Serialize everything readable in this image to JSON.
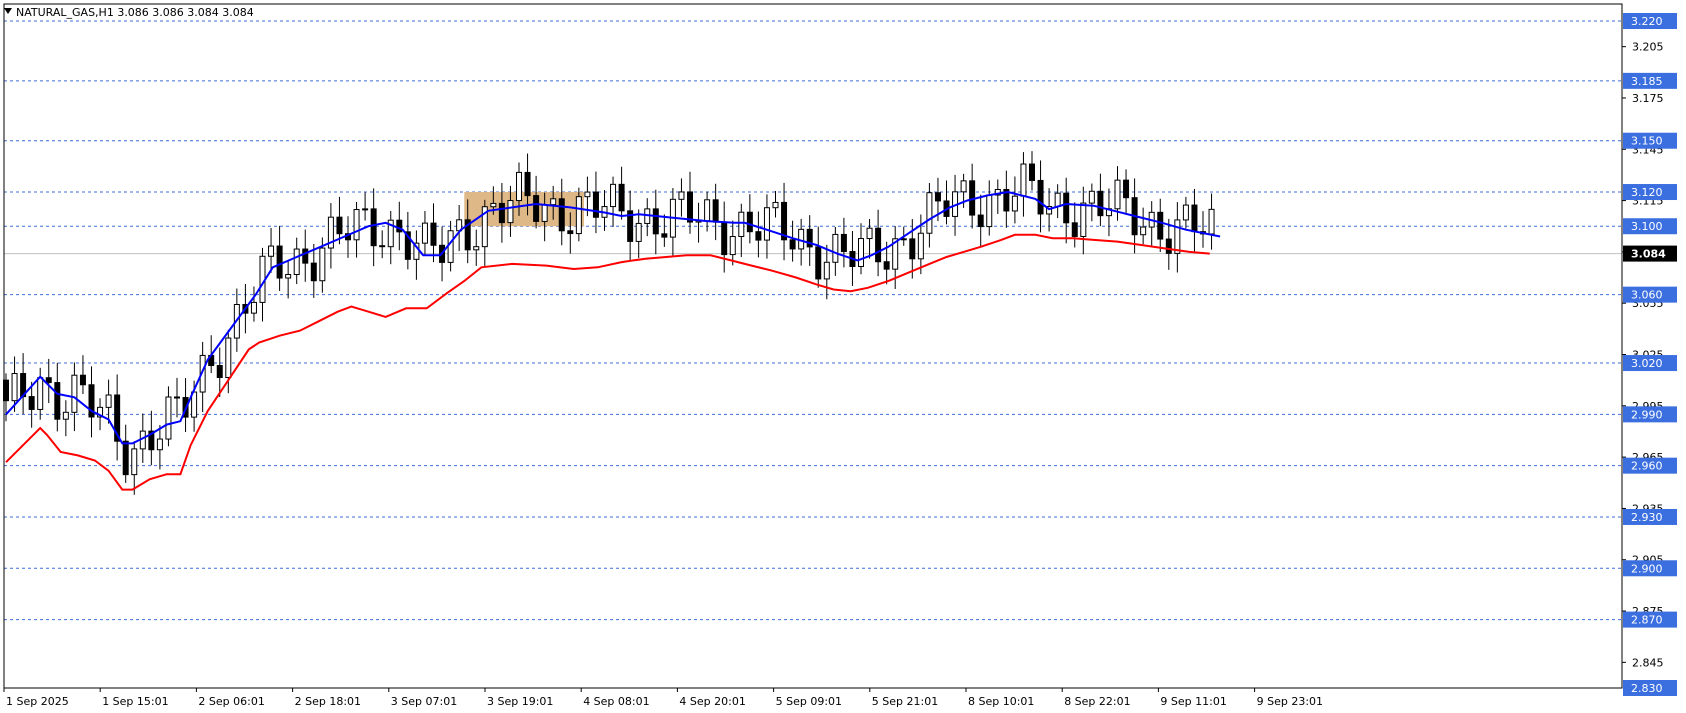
{
  "chart_data": {
    "type": "candlestick",
    "title": "NATURAL_GAS,H1  3.086 3.086 3.084 3.084",
    "symbol": "NATURAL_GAS,H1",
    "ohlc_header": "3.086 3.086 3.084 3.084",
    "current_price": 3.084,
    "ylim": [
      2.83,
      3.22
    ],
    "price_tick_labels": [
      "3.205",
      "3.175",
      "3.145",
      "3.115",
      "3.085",
      "3.055",
      "3.025",
      "2.995",
      "2.965",
      "2.935",
      "2.905",
      "2.875",
      "2.845"
    ],
    "horizontal_levels": [
      3.22,
      3.185,
      3.15,
      3.12,
      3.1,
      3.06,
      3.02,
      2.99,
      2.96,
      2.93,
      2.9,
      2.87,
      2.83
    ],
    "horizontal_level_labels": [
      "3.220",
      "3.185",
      "3.150",
      "3.120",
      "3.100",
      "3.060",
      "3.020",
      "2.990",
      "2.960",
      "2.930",
      "2.900",
      "2.870",
      "2.830"
    ],
    "time_labels": [
      "1 Sep 2025",
      "1 Sep 15:01",
      "2 Sep 06:01",
      "2 Sep 18:01",
      "3 Sep 07:01",
      "3 Sep 19:01",
      "4 Sep 08:01",
      "4 Sep 20:01",
      "5 Sep 09:01",
      "5 Sep 21:01",
      "8 Sep 10:01",
      "8 Sep 22:01",
      "9 Sep 11:01",
      "9 Sep 23:01"
    ],
    "zone": {
      "low": 3.1,
      "high": 3.12,
      "color": "#deb887",
      "start_index": 134,
      "end_index": 169
    },
    "series": [
      {
        "name": "",
        "color": "#0000ff",
        "points": [
          [
            0,
            2.99
          ],
          [
            10,
            3.012
          ],
          [
            11,
            3.01
          ],
          [
            15,
            3.002
          ],
          [
            20,
            3.0
          ],
          [
            25,
            2.992
          ],
          [
            30,
            2.987
          ],
          [
            34,
            2.973
          ],
          [
            37,
            2.973
          ],
          [
            42,
            2.978
          ],
          [
            47,
            2.984
          ],
          [
            51,
            2.986
          ],
          [
            54,
            3.0
          ],
          [
            59,
            3.022
          ],
          [
            66,
            3.041
          ],
          [
            73,
            3.06
          ],
          [
            78,
            3.076
          ],
          [
            85,
            3.082
          ],
          [
            92,
            3.088
          ],
          [
            99,
            3.094
          ],
          [
            106,
            3.1
          ],
          [
            111,
            3.102
          ],
          [
            116,
            3.098
          ],
          [
            122,
            3.083
          ],
          [
            127,
            3.083
          ],
          [
            133,
            3.098
          ],
          [
            141,
            3.109
          ],
          [
            148,
            3.111
          ],
          [
            155,
            3.113
          ],
          [
            165,
            3.111
          ],
          [
            175,
            3.108
          ],
          [
            180,
            3.106
          ],
          [
            185,
            3.107
          ],
          [
            195,
            3.105
          ],
          [
            205,
            3.103
          ],
          [
            213,
            3.102
          ],
          [
            216,
            3.102
          ],
          [
            224,
            3.097
          ],
          [
            230,
            3.093
          ],
          [
            237,
            3.089
          ],
          [
            243,
            3.084
          ],
          [
            249,
            3.08
          ],
          [
            253,
            3.083
          ],
          [
            258,
            3.088
          ],
          [
            264,
            3.096
          ],
          [
            270,
            3.104
          ],
          [
            276,
            3.111
          ],
          [
            281,
            3.115
          ],
          [
            287,
            3.118
          ],
          [
            293,
            3.12
          ],
          [
            301,
            3.116
          ],
          [
            305,
            3.11
          ],
          [
            310,
            3.113
          ],
          [
            318,
            3.112
          ],
          [
            324,
            3.109
          ],
          [
            330,
            3.106
          ],
          [
            338,
            3.102
          ],
          [
            345,
            3.098
          ],
          [
            355,
            3.094
          ]
        ]
      },
      {
        "name": "",
        "color": "#ff0000",
        "points": [
          [
            0,
            2.962
          ],
          [
            10,
            2.982
          ],
          [
            12,
            2.978
          ],
          [
            16,
            2.968
          ],
          [
            21,
            2.966
          ],
          [
            26,
            2.963
          ],
          [
            30,
            2.957
          ],
          [
            34,
            2.946
          ],
          [
            37,
            2.946
          ],
          [
            42,
            2.952
          ],
          [
            47,
            2.955
          ],
          [
            51,
            2.955
          ],
          [
            54,
            2.972
          ],
          [
            59,
            2.992
          ],
          [
            65,
            3.01
          ],
          [
            71,
            3.028
          ],
          [
            74,
            3.032
          ],
          [
            80,
            3.036
          ],
          [
            86,
            3.039
          ],
          [
            92,
            3.045
          ],
          [
            97,
            3.05
          ],
          [
            101,
            3.053
          ],
          [
            106,
            3.05
          ],
          [
            111,
            3.047
          ],
          [
            117,
            3.052
          ],
          [
            123,
            3.052
          ],
          [
            129,
            3.061
          ],
          [
            134,
            3.068
          ],
          [
            139,
            3.076
          ],
          [
            148,
            3.078
          ],
          [
            158,
            3.077
          ],
          [
            166,
            3.075
          ],
          [
            173,
            3.076
          ],
          [
            180,
            3.079
          ],
          [
            187,
            3.081
          ],
          [
            193,
            3.082
          ],
          [
            199,
            3.083
          ],
          [
            206,
            3.083
          ],
          [
            212,
            3.08
          ],
          [
            218,
            3.077
          ],
          [
            224,
            3.074
          ],
          [
            231,
            3.07
          ],
          [
            237,
            3.066
          ],
          [
            242,
            3.063
          ],
          [
            247,
            3.062
          ],
          [
            252,
            3.064
          ],
          [
            258,
            3.068
          ],
          [
            264,
            3.073
          ],
          [
            270,
            3.078
          ],
          [
            275,
            3.082
          ],
          [
            280,
            3.085
          ],
          [
            285,
            3.088
          ],
          [
            291,
            3.092
          ],
          [
            295,
            3.095
          ],
          [
            301,
            3.095
          ],
          [
            306,
            3.093
          ],
          [
            312,
            3.093
          ],
          [
            318,
            3.092
          ],
          [
            325,
            3.091
          ],
          [
            332,
            3.089
          ],
          [
            339,
            3.087
          ],
          [
            346,
            3.085
          ],
          [
            352,
            3.084
          ]
        ]
      }
    ],
    "candles_visible": 142
  }
}
